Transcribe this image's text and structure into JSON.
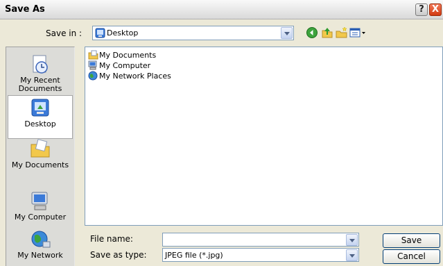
{
  "window": {
    "title": "Save As"
  },
  "titlebar_buttons": {
    "help": "?",
    "close": "X"
  },
  "savein": {
    "label": "Save in :",
    "value": "Desktop"
  },
  "toolbar": {
    "icons": [
      "back-icon",
      "up-folder-icon",
      "new-folder-icon",
      "view-menu-icon"
    ]
  },
  "places": [
    {
      "label": "My Recent Documents",
      "icon": "recent-documents-icon"
    },
    {
      "label": "Desktop",
      "icon": "desktop-icon",
      "selected": true
    },
    {
      "label": "My Documents",
      "icon": "my-documents-icon"
    },
    {
      "label": "My Computer",
      "icon": "my-computer-icon"
    },
    {
      "label": "My Network",
      "icon": "my-network-icon"
    }
  ],
  "files": [
    {
      "name": "My Documents",
      "icon": "folder-icon"
    },
    {
      "name": "My Computer",
      "icon": "computer-icon"
    },
    {
      "name": "My Network Places",
      "icon": "network-icon"
    }
  ],
  "filename": {
    "label": "File name:",
    "value": ""
  },
  "filetype": {
    "label": "Save as type:",
    "value": "JPEG file (*.jpg)"
  },
  "buttons": {
    "save": "Save",
    "cancel": "Cancel"
  }
}
